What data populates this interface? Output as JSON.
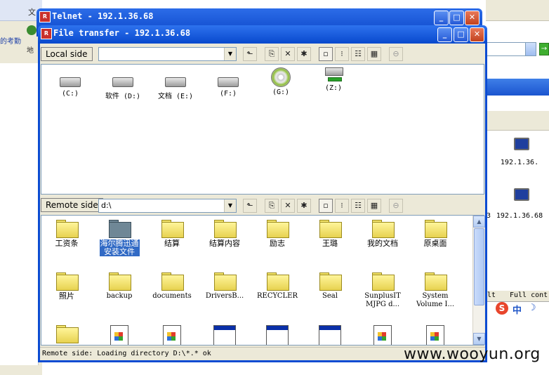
{
  "background": {
    "top_letter": "文",
    "left_link": "的考勤",
    "addr_label": "地",
    "right_hosts": [
      "192.1.36.",
      "192.1.36.68"
    ],
    "right_host_prefix": "3",
    "col_headers": [
      "lt",
      "Full cont"
    ],
    "ime_text": "中",
    "watermark": "www.wooyun.org",
    "go_glyph": "→"
  },
  "telnet_window": {
    "title": "Telnet - 192.1.36.68"
  },
  "file_transfer": {
    "title": "File transfer - 192.1.36.68",
    "local": {
      "label": "Local side",
      "path": "",
      "drives": [
        {
          "label": "(C:)",
          "type": "hdd"
        },
        {
          "label": "软件 (D:)",
          "type": "hdd"
        },
        {
          "label": "文档 (E:)",
          "type": "hdd"
        },
        {
          "label": "(F:)",
          "type": "hdd"
        },
        {
          "label": "(G:)",
          "type": "cd"
        },
        {
          "label": "(Z:)",
          "type": "net"
        }
      ]
    },
    "remote": {
      "label": "Remote side",
      "path": "d:\\",
      "items": [
        {
          "label": "工资条",
          "type": "folder"
        },
        {
          "label": "海尔腾迅通\n安装文件",
          "type": "folder",
          "selected": true
        },
        {
          "label": "结算",
          "type": "folder"
        },
        {
          "label": "结算内容",
          "type": "folder"
        },
        {
          "label": "励志",
          "type": "folder"
        },
        {
          "label": "王璐",
          "type": "folder"
        },
        {
          "label": "我的文档",
          "type": "folder"
        },
        {
          "label": "原桌面",
          "type": "folder"
        },
        {
          "label": "照片",
          "type": "folder"
        },
        {
          "label": "backup",
          "type": "folder"
        },
        {
          "label": "documents",
          "type": "folder"
        },
        {
          "label": "DriversB...",
          "type": "folder"
        },
        {
          "label": "RECYCLER",
          "type": "folder"
        },
        {
          "label": "Seal",
          "type": "folder"
        },
        {
          "label": "SunplusIT\nMJPG d...",
          "type": "folder"
        },
        {
          "label": "System\nVolume I...",
          "type": "folder"
        },
        {
          "label": "",
          "type": "folder"
        },
        {
          "label": "",
          "type": "exe"
        },
        {
          "label": "",
          "type": "exe"
        },
        {
          "label": "",
          "type": "window"
        },
        {
          "label": "",
          "type": "window"
        },
        {
          "label": "",
          "type": "window"
        },
        {
          "label": "",
          "type": "exe"
        },
        {
          "label": "",
          "type": "exe"
        }
      ]
    },
    "toolbar_icons": [
      "up-folder-icon",
      "copy-icon",
      "delete-icon",
      "new-folder-icon",
      "large-icons-view-icon",
      "small-icons-view-icon",
      "list-view-icon",
      "details-view-icon",
      "stop-icon"
    ],
    "toolbar_glyphs": {
      "up": "⬑",
      "copy": "⎘",
      "delete": "✕",
      "new": "✱",
      "large": "▫",
      "small": "⁝",
      "list": "☷",
      "details": "▦",
      "stop": "⊖"
    },
    "combo_glyph": "▼",
    "status": "Remote side: Loading directory D:\\*.* ok"
  },
  "window_controls": {
    "minimize": "_",
    "maximize": "□",
    "close": "✕"
  }
}
